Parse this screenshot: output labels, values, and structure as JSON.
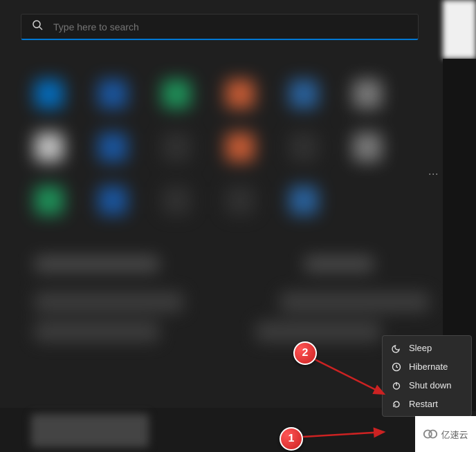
{
  "search": {
    "placeholder": "Type here to search"
  },
  "power_menu": {
    "items": [
      {
        "icon": "moon",
        "label": "Sleep"
      },
      {
        "icon": "clock",
        "label": "Hibernate"
      },
      {
        "icon": "power",
        "label": "Shut down"
      },
      {
        "icon": "restart",
        "label": "Restart"
      }
    ]
  },
  "annotations": {
    "badge1": "1",
    "badge2": "2"
  },
  "watermark": {
    "text": "亿速云"
  }
}
